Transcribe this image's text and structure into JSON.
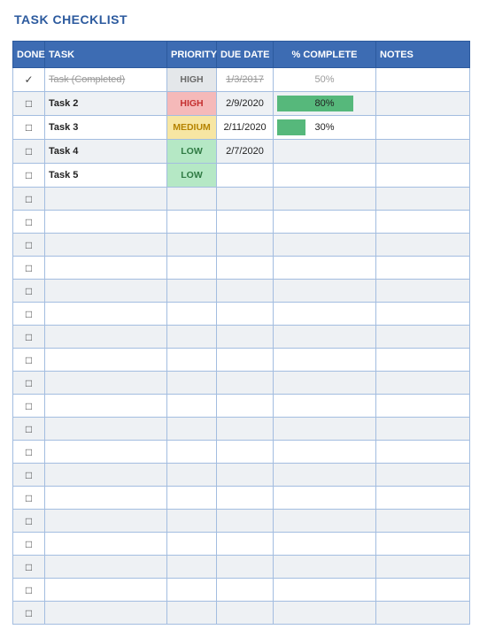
{
  "title": "TASK CHECKLIST",
  "columns": {
    "done": "DONE",
    "task": "TASK",
    "priority": "PRIORITY",
    "due_date": "DUE DATE",
    "pct_complete": "% COMPLETE",
    "notes": "NOTES"
  },
  "glyphs": {
    "checked": "✓",
    "unchecked": "□"
  },
  "rows": [
    {
      "done": true,
      "task": "Task (Completed)",
      "priority": "HIGH",
      "priority_style": "high-done",
      "due_date": "1/3/2017",
      "pct": 50,
      "pct_label": "50%",
      "show_bar": false,
      "notes": ""
    },
    {
      "done": false,
      "task": "Task 2",
      "priority": "HIGH",
      "priority_style": "high",
      "due_date": "2/9/2020",
      "pct": 80,
      "pct_label": "80%",
      "show_bar": true,
      "notes": ""
    },
    {
      "done": false,
      "task": "Task 3",
      "priority": "MEDIUM",
      "priority_style": "medium",
      "due_date": "2/11/2020",
      "pct": 30,
      "pct_label": "30%",
      "show_bar": true,
      "notes": ""
    },
    {
      "done": false,
      "task": "Task 4",
      "priority": "LOW",
      "priority_style": "low",
      "due_date": "2/7/2020",
      "pct": null,
      "pct_label": "",
      "show_bar": false,
      "notes": ""
    },
    {
      "done": false,
      "task": "Task 5",
      "priority": "LOW",
      "priority_style": "low",
      "due_date": "",
      "pct": null,
      "pct_label": "",
      "show_bar": false,
      "notes": ""
    },
    {
      "done": false,
      "task": "",
      "priority": "",
      "priority_style": "",
      "due_date": "",
      "pct": null,
      "pct_label": "",
      "show_bar": false,
      "notes": ""
    },
    {
      "done": false,
      "task": "",
      "priority": "",
      "priority_style": "",
      "due_date": "",
      "pct": null,
      "pct_label": "",
      "show_bar": false,
      "notes": ""
    },
    {
      "done": false,
      "task": "",
      "priority": "",
      "priority_style": "",
      "due_date": "",
      "pct": null,
      "pct_label": "",
      "show_bar": false,
      "notes": ""
    },
    {
      "done": false,
      "task": "",
      "priority": "",
      "priority_style": "",
      "due_date": "",
      "pct": null,
      "pct_label": "",
      "show_bar": false,
      "notes": ""
    },
    {
      "done": false,
      "task": "",
      "priority": "",
      "priority_style": "",
      "due_date": "",
      "pct": null,
      "pct_label": "",
      "show_bar": false,
      "notes": ""
    },
    {
      "done": false,
      "task": "",
      "priority": "",
      "priority_style": "",
      "due_date": "",
      "pct": null,
      "pct_label": "",
      "show_bar": false,
      "notes": ""
    },
    {
      "done": false,
      "task": "",
      "priority": "",
      "priority_style": "",
      "due_date": "",
      "pct": null,
      "pct_label": "",
      "show_bar": false,
      "notes": ""
    },
    {
      "done": false,
      "task": "",
      "priority": "",
      "priority_style": "",
      "due_date": "",
      "pct": null,
      "pct_label": "",
      "show_bar": false,
      "notes": ""
    },
    {
      "done": false,
      "task": "",
      "priority": "",
      "priority_style": "",
      "due_date": "",
      "pct": null,
      "pct_label": "",
      "show_bar": false,
      "notes": ""
    },
    {
      "done": false,
      "task": "",
      "priority": "",
      "priority_style": "",
      "due_date": "",
      "pct": null,
      "pct_label": "",
      "show_bar": false,
      "notes": ""
    },
    {
      "done": false,
      "task": "",
      "priority": "",
      "priority_style": "",
      "due_date": "",
      "pct": null,
      "pct_label": "",
      "show_bar": false,
      "notes": ""
    },
    {
      "done": false,
      "task": "",
      "priority": "",
      "priority_style": "",
      "due_date": "",
      "pct": null,
      "pct_label": "",
      "show_bar": false,
      "notes": ""
    },
    {
      "done": false,
      "task": "",
      "priority": "",
      "priority_style": "",
      "due_date": "",
      "pct": null,
      "pct_label": "",
      "show_bar": false,
      "notes": ""
    },
    {
      "done": false,
      "task": "",
      "priority": "",
      "priority_style": "",
      "due_date": "",
      "pct": null,
      "pct_label": "",
      "show_bar": false,
      "notes": ""
    },
    {
      "done": false,
      "task": "",
      "priority": "",
      "priority_style": "",
      "due_date": "",
      "pct": null,
      "pct_label": "",
      "show_bar": false,
      "notes": ""
    },
    {
      "done": false,
      "task": "",
      "priority": "",
      "priority_style": "",
      "due_date": "",
      "pct": null,
      "pct_label": "",
      "show_bar": false,
      "notes": ""
    },
    {
      "done": false,
      "task": "",
      "priority": "",
      "priority_style": "",
      "due_date": "",
      "pct": null,
      "pct_label": "",
      "show_bar": false,
      "notes": ""
    },
    {
      "done": false,
      "task": "",
      "priority": "",
      "priority_style": "",
      "due_date": "",
      "pct": null,
      "pct_label": "",
      "show_bar": false,
      "notes": ""
    },
    {
      "done": false,
      "task": "",
      "priority": "",
      "priority_style": "",
      "due_date": "",
      "pct": null,
      "pct_label": "",
      "show_bar": false,
      "notes": ""
    }
  ]
}
